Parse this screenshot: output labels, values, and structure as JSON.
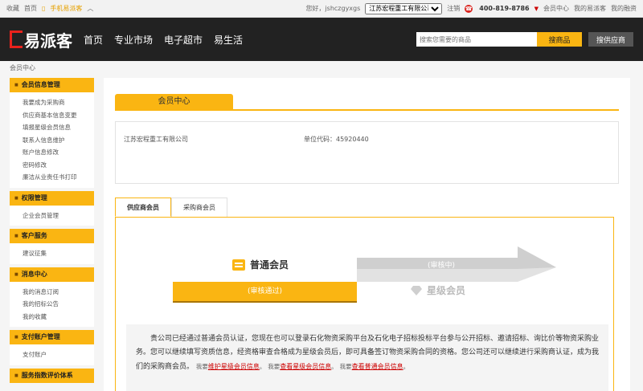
{
  "topbar": {
    "favorite": "收藏",
    "home": "首页",
    "mobile": "手机易派客",
    "greeting": "您好，jshczgyxgs",
    "company_select": "江苏宏程重工有限公司",
    "logout": "注销",
    "phone": "400-819-8786",
    "member_center": "会员中心",
    "my_epaike": "我的易派客",
    "my_finance": "我的融资"
  },
  "header": {
    "logo_text": "易派客",
    "nav": [
      "首页",
      "专业市场",
      "电子超市",
      "易生活"
    ],
    "search_placeholder": "搜索您需要的商品",
    "search_goods": "搜商品",
    "search_supplier": "搜供应商"
  },
  "breadcrumb": "会员中心",
  "sidebar": [
    {
      "title": "会员信息管理",
      "items": [
        "我要成为采购商",
        "供应商基本信息变更",
        "填报星级会员信息",
        "联系人信息维护",
        "账户信息修改",
        "密码修改",
        "廉洁从业责任书打印"
      ]
    },
    {
      "title": "权限管理",
      "items": [
        "企业会员管理"
      ]
    },
    {
      "title": "客户服务",
      "items": [
        "建议征集"
      ]
    },
    {
      "title": "消息中心",
      "items": [
        "我的消息订阅",
        "我的招标公告",
        "我的收藏"
      ]
    },
    {
      "title": "支付账户管理",
      "items": [
        "支付账户"
      ]
    },
    {
      "title": "服务指数评价体系",
      "items": []
    }
  ],
  "main": {
    "section_title": "会员中心",
    "company_name": "江苏宏程重工有限公司",
    "unit_code": "单位代码：45920440",
    "tabs": [
      "供应商会员",
      "采购商会员"
    ],
    "level1_label": "普通会员",
    "level1_status": "(审核通过)",
    "level2_status": "(审核中)",
    "level2_label": "星级会员",
    "desc_text": "贵公司已经通过普通会员认证，您现在也可以登录石化物资采购平台及石化电子招标投标平台参与公开招标、邀请招标、询比价等物资采购业务。您可以继续填写资质信息，经资格审查合格成为星级会员后，即可具备签订物资采购合同的资格。您公司还可以继续进行采购商认证，成为我们的采购商会员。",
    "want1": "我要",
    "link1": "维护星级会员信息",
    "want2": "我要",
    "link2": "查看星级会员信息",
    "want3": "我要",
    "link3": "查看普通会员信息",
    "period": "。"
  },
  "colors": {
    "accent": "#fab512",
    "header_bg": "#222222",
    "link_red": "#cc0000"
  }
}
